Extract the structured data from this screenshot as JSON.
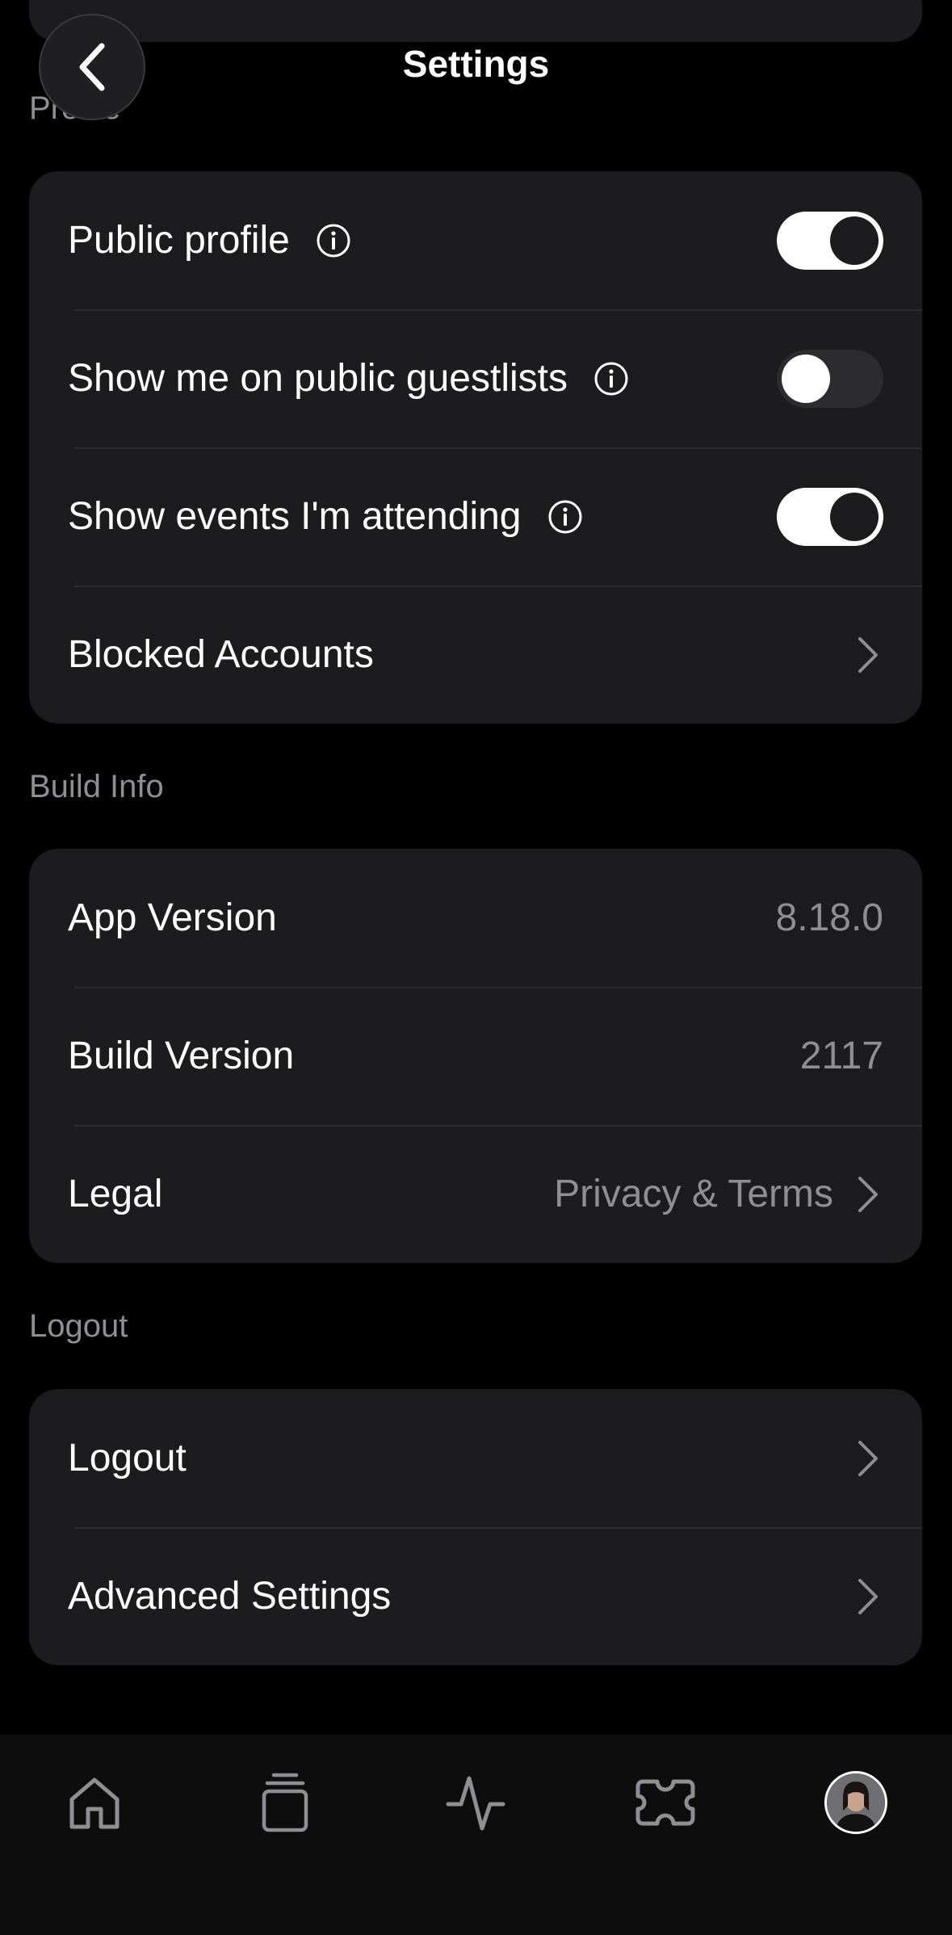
{
  "header": {
    "title": "Settings",
    "back_icon": "chevron-left-icon"
  },
  "sections": {
    "profile": {
      "label": "Profile",
      "rows": {
        "public_profile": {
          "label": "Public profile",
          "enabled": true
        },
        "public_guestlists": {
          "label": "Show me on public guestlists",
          "enabled": false
        },
        "events_attending": {
          "label": "Show events I'm attending",
          "enabled": true
        },
        "blocked_accounts": {
          "label": "Blocked Accounts"
        }
      }
    },
    "build_info": {
      "label": "Build Info",
      "rows": {
        "app_version": {
          "label": "App Version",
          "value": "8.18.0"
        },
        "build_version": {
          "label": "Build Version",
          "value": "2117"
        },
        "legal": {
          "label": "Legal",
          "value": "Privacy & Terms"
        }
      }
    },
    "logout": {
      "label": "Logout",
      "rows": {
        "logout": {
          "label": "Logout"
        },
        "advanced": {
          "label": "Advanced Settings"
        }
      }
    }
  },
  "tabbar": {
    "items": [
      "home-icon",
      "stack-icon",
      "activity-icon",
      "ticket-icon",
      "profile-avatar"
    ]
  },
  "colors": {
    "background": "#000000",
    "card": "#1c1c1e",
    "secondary_text": "#8e8e93",
    "toggle_on": "#ffffff",
    "toggle_off": "#2c2c2e"
  }
}
